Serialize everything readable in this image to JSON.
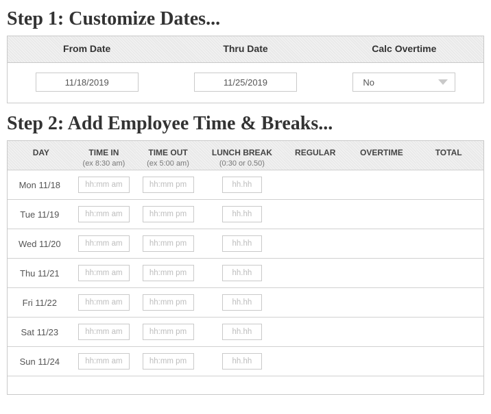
{
  "step1": {
    "heading": "Step 1: Customize Dates...",
    "cols": {
      "from": "From Date",
      "thru": "Thru Date",
      "calc": "Calc Overtime"
    },
    "from_value": "11/18/2019",
    "thru_value": "11/25/2019",
    "calc_value": "No"
  },
  "step2": {
    "heading": "Step 2: Add Employee Time & Breaks...",
    "headers": {
      "day": "DAY",
      "time_in": "TIME IN",
      "time_in_hint": "(ex 8:30 am)",
      "time_out": "TIME OUT",
      "time_out_hint": "(ex 5:00 am)",
      "lunch": "LUNCH BREAK",
      "lunch_hint": "(0:30 or 0.50)",
      "regular": "REGULAR",
      "overtime": "OVERTIME",
      "total": "TOTAL"
    },
    "placeholders": {
      "time_in": "hh:mm am",
      "time_out": "hh:mm pm",
      "lunch": "hh.hh"
    },
    "rows": [
      {
        "day": "Mon 11/18"
      },
      {
        "day": "Tue 11/19"
      },
      {
        "day": "Wed 11/20"
      },
      {
        "day": "Thu 11/21"
      },
      {
        "day": "Fri 11/22"
      },
      {
        "day": "Sat 11/23"
      },
      {
        "day": "Sun 11/24"
      }
    ]
  }
}
